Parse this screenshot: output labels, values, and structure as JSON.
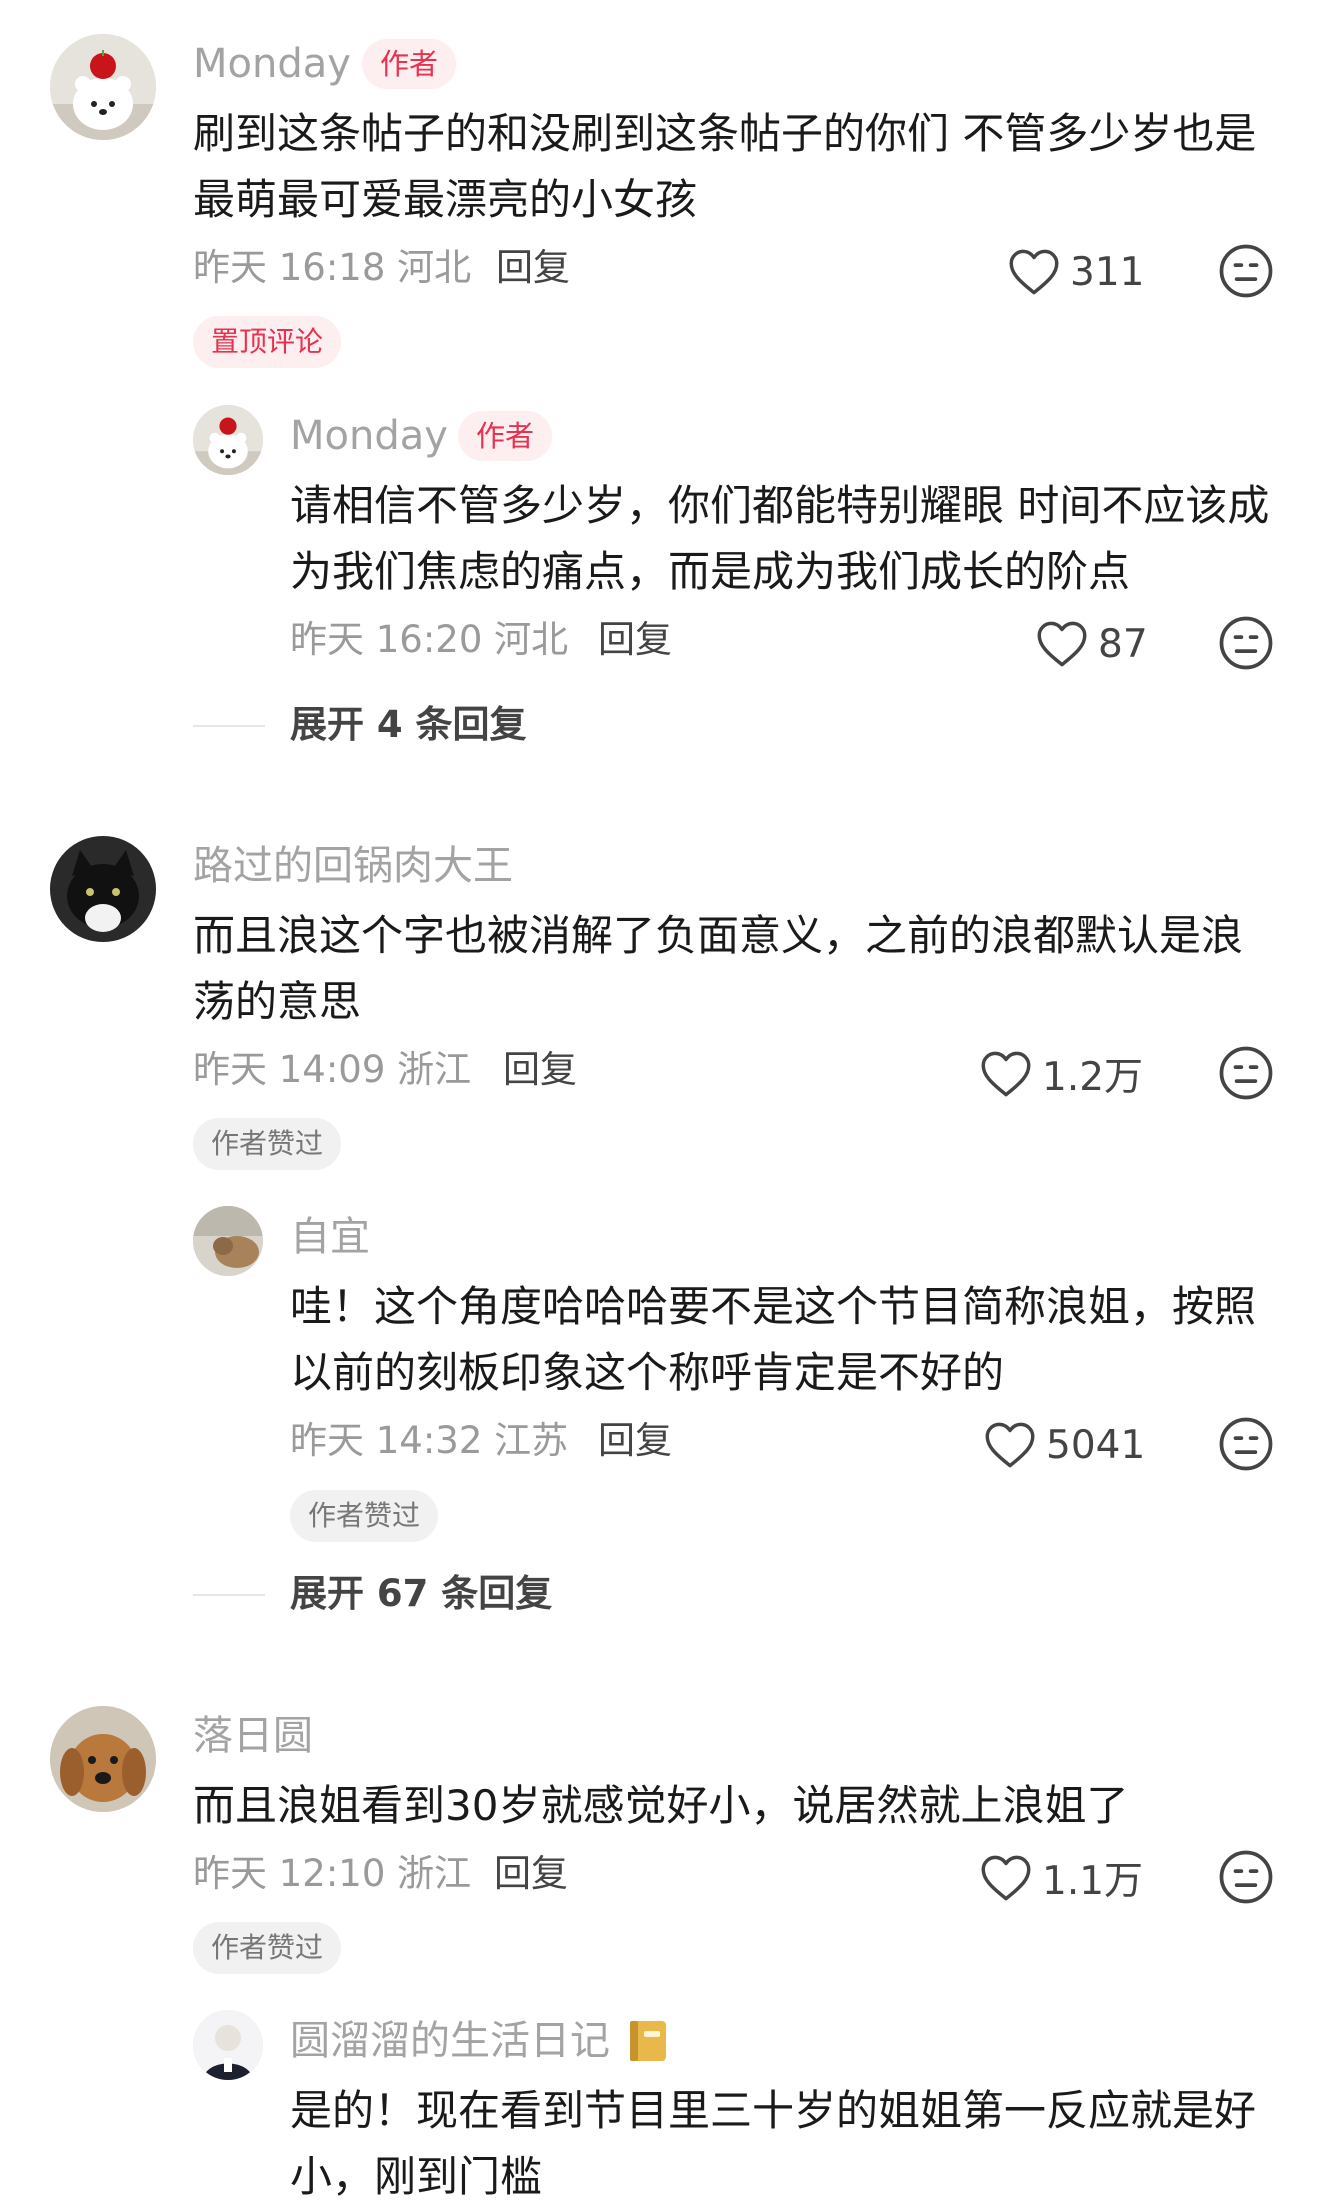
{
  "comments": [
    {
      "name": "Monday",
      "author_tag": "作者",
      "lines": [
        "刷到这条帖子的和没刷到这条帖子的你们 不管多少岁也是",
        "最萌最可爱最漂亮的小女孩"
      ],
      "meta": "昨天 16:18 河北",
      "reply": "回复",
      "likes": "311",
      "badge": "置顶评论",
      "replies": [
        {
          "name": "Monday",
          "author_tag": "作者",
          "lines": [
            "请相信不管多少岁，你们都能特别耀眼 时间不应该成",
            "为我们焦虑的痛点，而是成为我们成长的阶点"
          ],
          "meta": "昨天 16:20 河北",
          "reply": "回复",
          "likes": "87"
        }
      ],
      "expand": "展开 4 条回复"
    },
    {
      "name": "路过的回锅肉大王",
      "lines": [
        "而且浪这个字也被消解了负面意义，之前的浪都默认是浪",
        "荡的意思"
      ],
      "meta": "昨天 14:09 浙江",
      "reply": "回复",
      "likes": "1.2万",
      "badge": "作者赞过",
      "replies": [
        {
          "name": "自宜",
          "lines": [
            "哇！这个角度哈哈哈要不是这个节目简称浪姐，按照",
            "以前的刻板印象这个称呼肯定是不好的"
          ],
          "meta": "昨天 14:32 江苏",
          "reply": "回复",
          "likes": "5041",
          "badge": "作者赞过"
        }
      ],
      "expand": "展开 67 条回复"
    },
    {
      "name": "落日圆",
      "lines": [
        "而且浪姐看到30岁就感觉好小，说居然就上浪姐了"
      ],
      "meta": "昨天 12:10 浙江",
      "reply": "回复",
      "likes": "1.1万",
      "badge": "作者赞过",
      "replies": [
        {
          "name": "圆溜溜的生活日记",
          "lines": [
            "是的！现在看到节目里三十岁的姐姐第一反应就是好",
            "小，刚到门槛"
          ]
        }
      ]
    }
  ],
  "colors": {
    "author_tag": "#e8314f",
    "author_tag_bg": "#fdeef0",
    "name": "#a3a3a3"
  }
}
